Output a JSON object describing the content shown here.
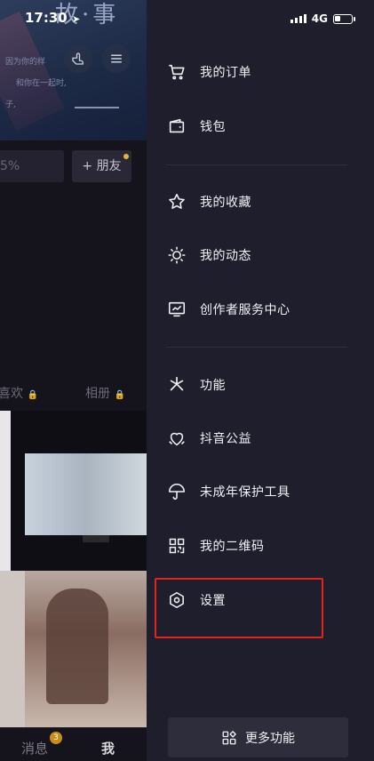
{
  "status_bar": {
    "time": "17:30",
    "network": "4G"
  },
  "background": {
    "cover_title": "故·事",
    "cover_lines": [
      "因为你的样",
      "和你在一起时,",
      "子,"
    ],
    "stat_value": "5%",
    "friend_button": "+ 朋友",
    "tabs": {
      "likes": "喜欢",
      "albums": "相册"
    },
    "nav": {
      "messages": "消息",
      "messages_badge": "3",
      "me": "我"
    }
  },
  "menu": {
    "items": [
      {
        "label": "我的订单",
        "icon": "cart-icon"
      },
      {
        "label": "钱包",
        "icon": "wallet-icon"
      },
      {
        "label": "我的收藏",
        "icon": "star-icon"
      },
      {
        "label": "我的动态",
        "icon": "sun-icon"
      },
      {
        "label": "创作者服务中心",
        "icon": "chart-screen-icon"
      },
      {
        "label": "功能",
        "icon": "sparkle-icon"
      },
      {
        "label": "抖音公益",
        "icon": "heart-hands-icon"
      },
      {
        "label": "未成年保护工具",
        "icon": "umbrella-icon"
      },
      {
        "label": "我的二维码",
        "icon": "qrcode-icon"
      },
      {
        "label": "设置",
        "icon": "hexagon-settings-icon"
      }
    ],
    "more_button": "更多功能"
  },
  "colors": {
    "drawer_bg": "#1f1e2d",
    "highlight_border": "#e3231e",
    "badge": "#cc8d17"
  }
}
